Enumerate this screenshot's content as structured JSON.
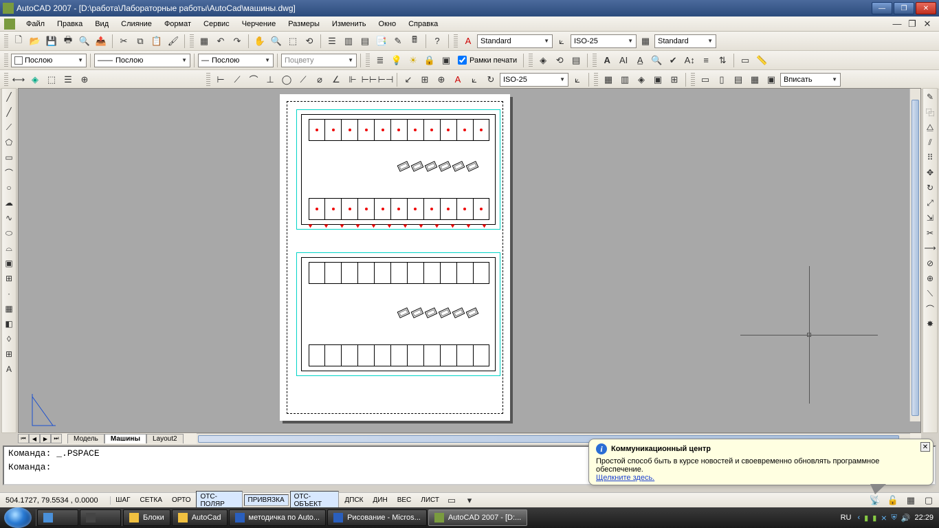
{
  "window": {
    "title": "AutoCAD 2007 - [D:\\работа\\Лабораторные работы\\AutoCad\\машины.dwg]"
  },
  "menu": {
    "items": [
      "Файл",
      "Правка",
      "Вид",
      "Слияние",
      "Формат",
      "Сервис",
      "Черчение",
      "Размеры",
      "Изменить",
      "Окно",
      "Справка"
    ]
  },
  "styles": {
    "text": "Standard",
    "dim": "ISO-25",
    "table": "Standard",
    "dim2": "ISO-25",
    "view": "Вписать"
  },
  "layer": {
    "line_style": "Послою",
    "line_style2": "Послою",
    "line_style3": "Послою",
    "color_by": "Поцвету"
  },
  "checkbox": {
    "plot_frames": "Рамки печати"
  },
  "tabs": {
    "items": [
      "Модель",
      "Машины",
      "Layout2"
    ],
    "active": 1
  },
  "cmd": {
    "prev": "Команда: _.PSPACE",
    "cur": "Команда:"
  },
  "balloon": {
    "title": "Коммуникационный центр",
    "body": "Простой способ быть в курсе новостей и своевременно обновлять программное обеспечение.",
    "link": "Щелкните здесь."
  },
  "status": {
    "coords": "504.1727,  79.5534 , 0.0000",
    "toggles": [
      "ШАГ",
      "СЕТКА",
      "ОРТО",
      "ОТС-ПОЛЯР",
      "ПРИВЯЗКА",
      "ОТС-ОБЪЕКТ",
      "ДПСК",
      "ДИН",
      "ВЕС",
      "ЛИСТ"
    ],
    "active": [
      3,
      4,
      5
    ]
  },
  "taskbar": {
    "items": [
      {
        "label": "Блоки",
        "color": "#f0c040"
      },
      {
        "label": "AutoCad",
        "color": "#f0c040"
      },
      {
        "label": "методичка по Auto...",
        "color": "#2a5fbd"
      },
      {
        "label": "Рисование - Micros...",
        "color": "#2a5fbd"
      },
      {
        "label": "AutoCAD 2007 - [D:...",
        "color": "#7a9b3f"
      }
    ],
    "active": 4,
    "lang": "RU",
    "time": "22:29"
  }
}
